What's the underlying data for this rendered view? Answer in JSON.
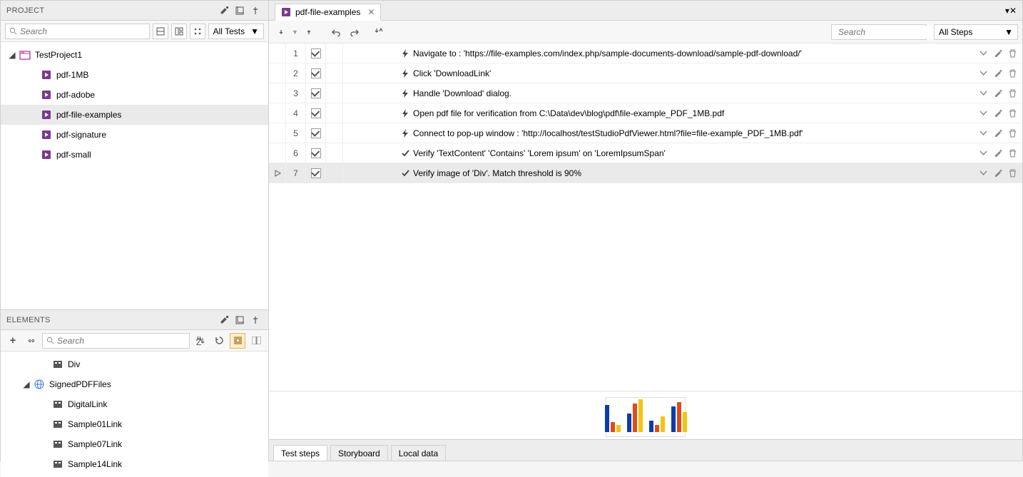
{
  "project_panel": {
    "title": "PROJECT",
    "search_placeholder": "Search",
    "filter_label": "All Tests",
    "root": "TestProject1",
    "items": [
      "pdf-1MB",
      "pdf-adobe",
      "pdf-file-examples",
      "pdf-signature",
      "pdf-small"
    ],
    "selected_index": 2
  },
  "elements_panel": {
    "title": "ELEMENTS",
    "search_placeholder": "Search",
    "root": "Div",
    "group": "SignedPDFFiles",
    "items": [
      "DigitalLink",
      "Sample01Link",
      "Sample07Link",
      "Sample14Link"
    ]
  },
  "editor": {
    "tab_title": "pdf-file-examples",
    "search_placeholder": "Search",
    "filter_label": "All Steps",
    "icon_names": [
      "bolt",
      "bolt",
      "bolt",
      "bolt",
      "bolt",
      "check",
      "check"
    ],
    "steps": [
      "Navigate to : 'https://file-examples.com/index.php/sample-documents-download/sample-pdf-download/'",
      "Click 'DownloadLink'",
      "Handle 'Download' dialog.",
      "Open pdf file for verification from C:\\Data\\dev\\blog\\pdf\\file-example_PDF_1MB.pdf",
      "Connect to pop-up window : 'http://localhost/testStudioPdfViewer.html?file=file-example_PDF_1MB.pdf'",
      "Verify 'TextContent' 'Contains' 'Lorem ipsum' on 'LoremIpsumSpan'",
      "Verify image of 'Div'. Match threshold is 90%"
    ],
    "selected_index": 6,
    "bottom_tabs": [
      "Test steps",
      "Storyboard",
      "Local data"
    ],
    "active_bottom_tab": 0
  }
}
